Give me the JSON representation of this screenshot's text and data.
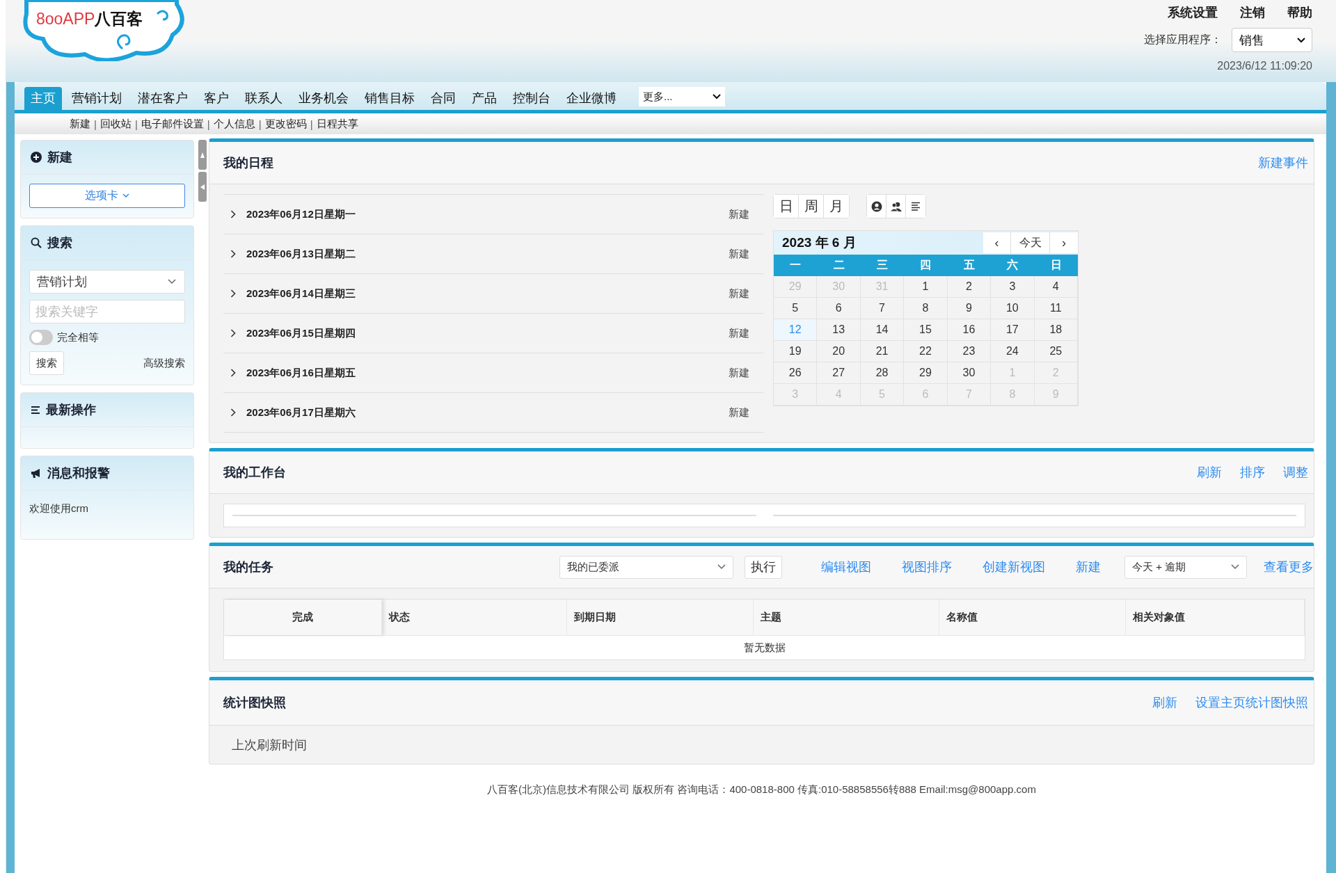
{
  "logo": {
    "brand": "8ooAPP",
    "brand_cn": "八百客"
  },
  "top_links": [
    "系统设置",
    "注销",
    "帮助"
  ],
  "app_select": {
    "label": "选择应用程序：",
    "value": "销售"
  },
  "datetime": "2023/6/12 11:09:20",
  "nav_tabs": [
    {
      "label": "主页",
      "selected": true
    },
    {
      "label": "营销计划",
      "selected": false
    },
    {
      "label": "潜在客户",
      "selected": false
    },
    {
      "label": "客户",
      "selected": false
    },
    {
      "label": "联系人",
      "selected": false
    },
    {
      "label": "业务机会",
      "selected": false
    },
    {
      "label": "销售目标",
      "selected": false
    },
    {
      "label": "合同",
      "selected": false
    },
    {
      "label": "产品",
      "selected": false
    },
    {
      "label": "控制台",
      "selected": false
    },
    {
      "label": "企业微博",
      "selected": false
    }
  ],
  "nav_more": {
    "value": "更多..."
  },
  "sub_nav": [
    {
      "kind": "link",
      "text": "新建"
    },
    {
      "kind": "separator",
      "text": "|"
    },
    {
      "kind": "link",
      "text": "回收站"
    },
    {
      "kind": "separator",
      "text": "|"
    },
    {
      "kind": "link",
      "text": "电子邮件设置"
    },
    {
      "kind": "separator",
      "text": "|"
    },
    {
      "kind": "link",
      "text": "个人信息"
    },
    {
      "kind": "separator",
      "text": "|"
    },
    {
      "kind": "link",
      "text": "更改密码"
    },
    {
      "kind": "separator",
      "text": "|"
    },
    {
      "kind": "link",
      "text": "日程共享"
    }
  ],
  "sidebar": {
    "new_panel": {
      "title": "新建",
      "button": "选项卡"
    },
    "search_panel": {
      "title": "搜索",
      "module": "营销计划",
      "keyword": {
        "placeholder": "搜索关键字"
      },
      "exact_match": {
        "label": "完全相等",
        "on": false
      },
      "search_button": "搜索",
      "advanced_link": "高级搜索"
    },
    "recent_panel": {
      "title": "最新操作"
    },
    "messages_panel": {
      "title": "消息和报警",
      "text": "欢迎使用crm"
    }
  },
  "schedule": {
    "title": "我的日程",
    "action": "新建事件",
    "days": [
      {
        "date": "2023年06月12日星期一",
        "action": "新建"
      },
      {
        "date": "2023年06月13日星期二",
        "action": "新建"
      },
      {
        "date": "2023年06月14日星期三",
        "action": "新建"
      },
      {
        "date": "2023年06月15日星期四",
        "action": "新建"
      },
      {
        "date": "2023年06月16日星期五",
        "action": "新建"
      },
      {
        "date": "2023年06月17日星期六",
        "action": "新建"
      }
    ],
    "view_buttons": [
      "日",
      "周",
      "月"
    ],
    "calendar": {
      "title": "2023 年 6 月",
      "prev": "‹",
      "today": "今天",
      "next": "›",
      "weekdays": [
        "一",
        "二",
        "三",
        "四",
        "五",
        "六",
        "日"
      ],
      "weeks": [
        [
          {
            "day": "29",
            "other_month": true,
            "selected": false
          },
          {
            "day": "30",
            "other_month": true,
            "selected": false
          },
          {
            "day": "31",
            "other_month": true,
            "selected": false
          },
          {
            "day": "1",
            "other_month": false,
            "selected": false
          },
          {
            "day": "2",
            "other_month": false,
            "selected": false
          },
          {
            "day": "3",
            "other_month": false,
            "selected": false
          },
          {
            "day": "4",
            "other_month": false,
            "selected": false
          }
        ],
        [
          {
            "day": "5",
            "other_month": false,
            "selected": false
          },
          {
            "day": "6",
            "other_month": false,
            "selected": false
          },
          {
            "day": "7",
            "other_month": false,
            "selected": false
          },
          {
            "day": "8",
            "other_month": false,
            "selected": false
          },
          {
            "day": "9",
            "other_month": false,
            "selected": false
          },
          {
            "day": "10",
            "other_month": false,
            "selected": false
          },
          {
            "day": "11",
            "other_month": false,
            "selected": false
          }
        ],
        [
          {
            "day": "12",
            "other_month": false,
            "selected": true
          },
          {
            "day": "13",
            "other_month": false,
            "selected": false
          },
          {
            "day": "14",
            "other_month": false,
            "selected": false
          },
          {
            "day": "15",
            "other_month": false,
            "selected": false
          },
          {
            "day": "16",
            "other_month": false,
            "selected": false
          },
          {
            "day": "17",
            "other_month": false,
            "selected": false
          },
          {
            "day": "18",
            "other_month": false,
            "selected": false
          }
        ],
        [
          {
            "day": "19",
            "other_month": false,
            "selected": false
          },
          {
            "day": "20",
            "other_month": false,
            "selected": false
          },
          {
            "day": "21",
            "other_month": false,
            "selected": false
          },
          {
            "day": "22",
            "other_month": false,
            "selected": false
          },
          {
            "day": "23",
            "other_month": false,
            "selected": false
          },
          {
            "day": "24",
            "other_month": false,
            "selected": false
          },
          {
            "day": "25",
            "other_month": false,
            "selected": false
          }
        ],
        [
          {
            "day": "26",
            "other_month": false,
            "selected": false
          },
          {
            "day": "27",
            "other_month": false,
            "selected": false
          },
          {
            "day": "28",
            "other_month": false,
            "selected": false
          },
          {
            "day": "29",
            "other_month": false,
            "selected": false
          },
          {
            "day": "30",
            "other_month": false,
            "selected": false
          },
          {
            "day": "1",
            "other_month": true,
            "selected": false
          },
          {
            "day": "2",
            "other_month": true,
            "selected": false
          }
        ],
        [
          {
            "day": "3",
            "other_month": true,
            "selected": false
          },
          {
            "day": "4",
            "other_month": true,
            "selected": false
          },
          {
            "day": "5",
            "other_month": true,
            "selected": false
          },
          {
            "day": "6",
            "other_month": true,
            "selected": false
          },
          {
            "day": "7",
            "other_month": true,
            "selected": false
          },
          {
            "day": "8",
            "other_month": true,
            "selected": false
          },
          {
            "day": "9",
            "other_month": true,
            "selected": false
          }
        ]
      ]
    }
  },
  "workbench": {
    "title": "我的工作台",
    "actions": [
      "刷新",
      "排序",
      "调整"
    ]
  },
  "tasks": {
    "title": "我的任务",
    "view_select": "我的已委派",
    "execute": "执行",
    "links": [
      "编辑视图",
      "视图排序",
      "创建新视图",
      "新建"
    ],
    "filter_select": "今天 + 逾期",
    "more": "查看更多",
    "columns": [
      "完成",
      "状态",
      "到期日期",
      "主题",
      "名称值",
      "相关对象值"
    ],
    "empty": "暂无数据"
  },
  "stats": {
    "title": "统计图快照",
    "actions": [
      "刷新",
      "设置主页统计图快照"
    ],
    "text": "上次刷新时间"
  },
  "footer": "八百客(北京)信息技术有限公司 版权所有 咨询电话：400-0818-800 传真:010-58858556转888 Email:msg@800app.com"
}
